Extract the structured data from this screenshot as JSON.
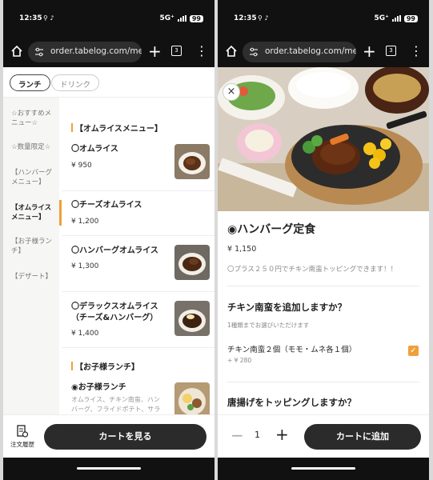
{
  "status": {
    "time": "12:35",
    "network": "5G⁺",
    "battery": "99"
  },
  "browser": {
    "url": "order.tabelog.com/menu",
    "tab_count": "3"
  },
  "left": {
    "category_tabs": [
      "ランチ",
      "ドリンク"
    ],
    "sidebar": [
      "☆おすすめメニュー☆",
      "☆数量限定☆",
      "【ハンバーグメニュー】",
      "【オムライスメニュー】",
      "【お子様ランチ】",
      "【デザート】"
    ],
    "section_omurice": "【オムライスメニュー】",
    "items": [
      {
        "name": "〇オムライス",
        "price": "¥ 950"
      },
      {
        "name": "〇チーズオムライス",
        "price": "¥ 1,200"
      },
      {
        "name": "〇ハンバーグオムライス",
        "price": "¥ 1,300"
      },
      {
        "name": "〇デラックスオムライス（チーズ&ハンバーグ）",
        "price": "¥ 1,400"
      }
    ],
    "section_kids": "【お子様ランチ】",
    "kids_item": {
      "name": "◉お子様ランチ",
      "desc": "オムライス、チキン南蛮、ハンバーグ、フライドポテト、サラダ、"
    },
    "order_history_label": "注文履歴",
    "cart_button": "カートを見る"
  },
  "right": {
    "title": "◉ハンバーグ定食",
    "price": "¥ 1,150",
    "note": "〇プラス２５０円でチキン南蛮トッピングできます！！",
    "question1": "チキン南蛮を追加しますか？",
    "question1_sub": "1種類までお選びいただけます",
    "option1": "チキン南蛮２個（モモ・ムネ各１個）",
    "option1_price": "+ ¥ 280",
    "option1_checked": true,
    "question2": "唐揚げをトッピングしますか？",
    "quantity": "1",
    "add_button": "カートに追加"
  },
  "colors": {
    "accent": "#f0a03a",
    "button": "#2b2b2b"
  }
}
